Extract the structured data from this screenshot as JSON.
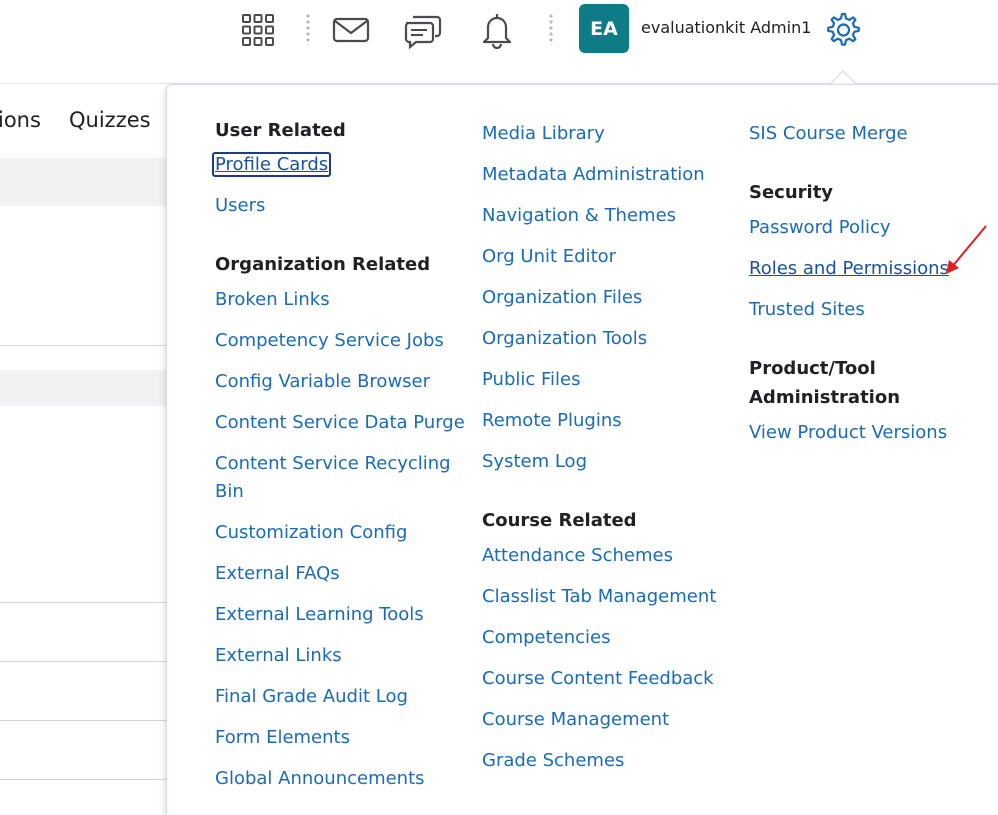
{
  "header": {
    "icons": [
      "apps-grid-icon",
      "mail-icon",
      "chat-icon",
      "bell-icon",
      "gear-icon"
    ],
    "avatar_initials": "EA",
    "username": "evaluationkit Admin1",
    "avatar_color": "#0e7c86"
  },
  "background": {
    "tabs": [
      "ions",
      "Quizzes"
    ]
  },
  "menu": {
    "col1": {
      "user_related_title": "User Related",
      "user_related": [
        "Profile Cards",
        "Users"
      ],
      "org_related_title": "Organization Related",
      "org_related": [
        "Broken Links",
        "Competency Service Jobs",
        "Config Variable Browser",
        "Content Service Data Purge",
        "Content Service Recycling Bin",
        "Customization Config",
        "External FAQs",
        "External Learning Tools",
        "External Links",
        "Final Grade Audit Log",
        "Form Elements",
        "Global Announcements"
      ]
    },
    "col2": {
      "org_related_cont": [
        "Media Library",
        "Metadata Administration",
        "Navigation & Themes",
        "Org Unit Editor",
        "Organization Files",
        "Organization Tools",
        "Public Files",
        "Remote Plugins",
        "System Log"
      ],
      "course_related_title": "Course Related",
      "course_related": [
        "Attendance Schemes",
        "Classlist Tab Management",
        "Competencies",
        "Course Content Feedback",
        "Course Management",
        "Grade Schemes"
      ]
    },
    "col3": {
      "course_related_cont": [
        "SIS Course Merge"
      ],
      "security_title": "Security",
      "security": [
        "Password Policy",
        "Roles and Permissions",
        "Trusted Sites"
      ],
      "product_title_line1": "Product/Tool",
      "product_title_line2": "Administration",
      "product": [
        "View Product Versions"
      ]
    }
  },
  "colors": {
    "link": "#1a6bb7",
    "annotation_arrow": "#e02020"
  }
}
